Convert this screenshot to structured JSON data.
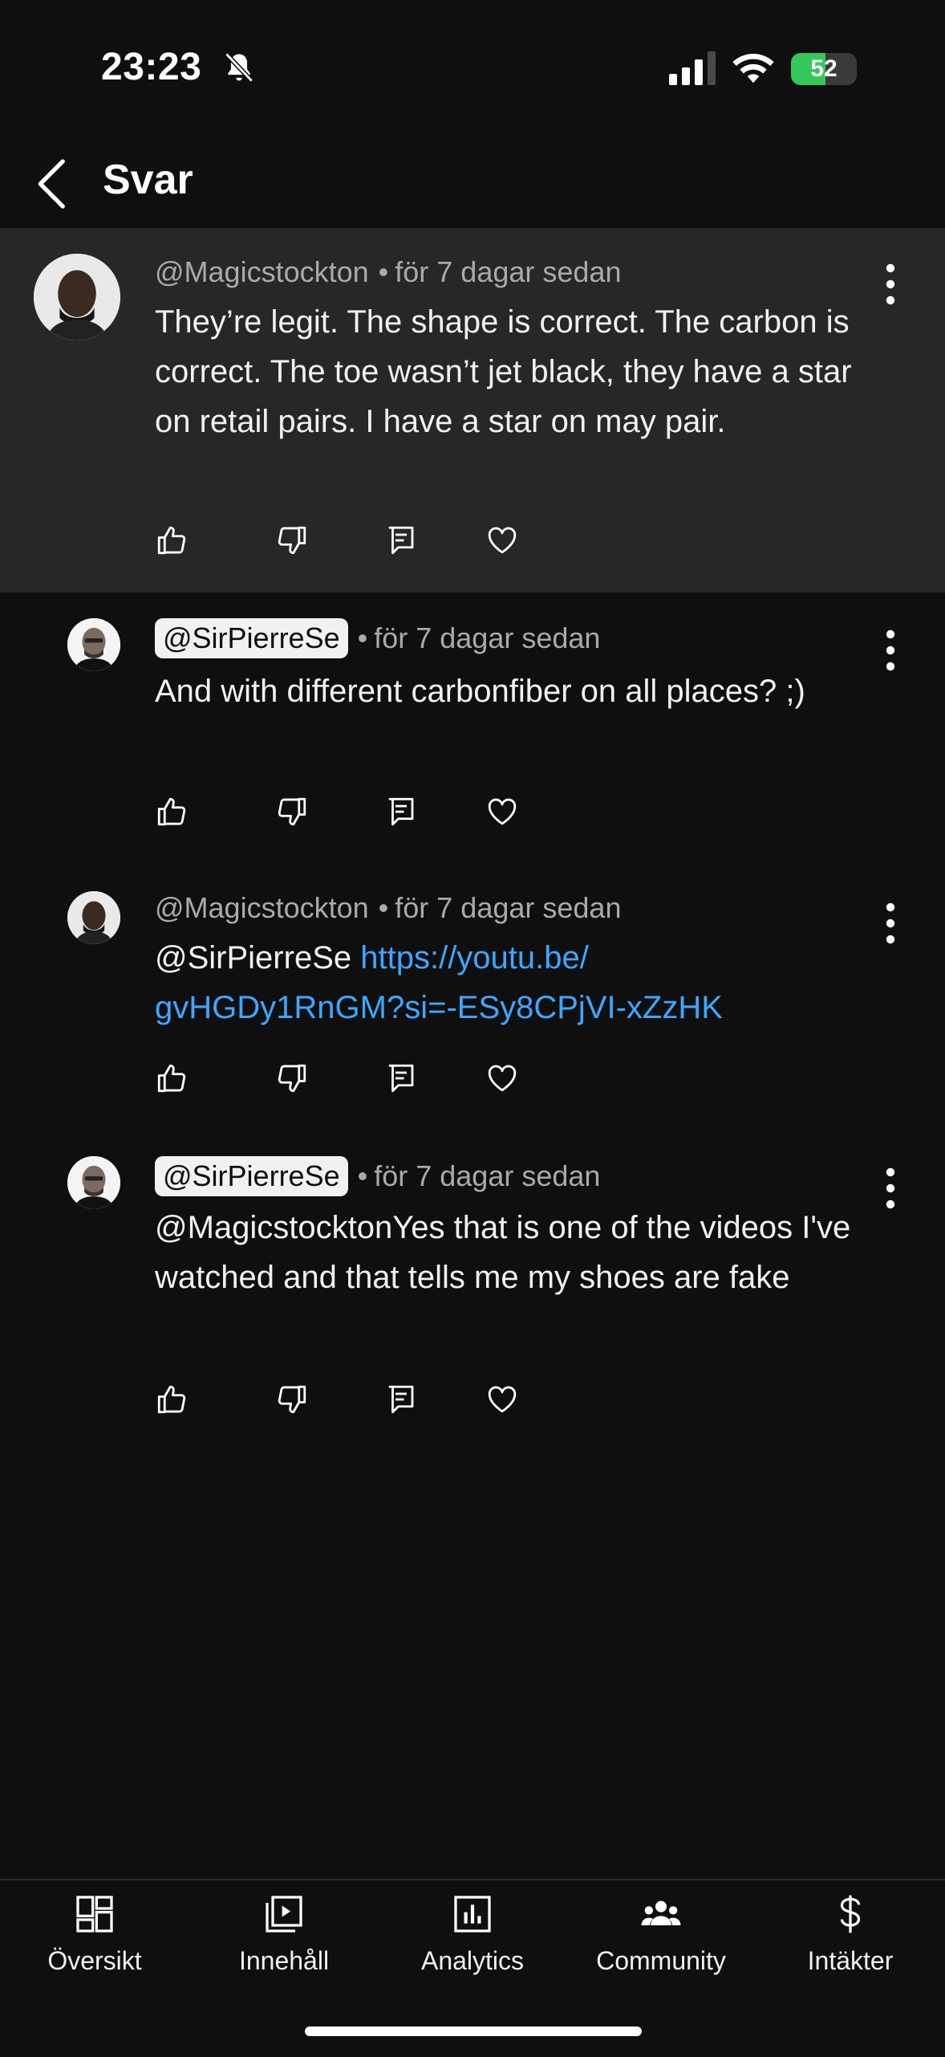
{
  "status_bar": {
    "time": "23:23",
    "battery": "52",
    "battery_level": 0.52
  },
  "header": {
    "title": "Svar"
  },
  "comments": [
    {
      "author": "@Magicstockton",
      "separator": "•",
      "time": "för 7 dagar sedan",
      "text": "They’re legit. The shape is correct. The carbon is correct. The toe wasn’t jet black, they have a star on retail pairs. I have a star on may pair."
    },
    {
      "author": "@SirPierreSe",
      "separator": "•",
      "time": "för 7 dagar sedan",
      "text": "And with different carbonfiber on all places? ;)"
    },
    {
      "author": "@Magicstockton",
      "separator": "•",
      "time": "för 7 dagar sedan",
      "mention": "@SirPierreSe",
      "link": "https://youtu.be/gvHGDy1RnGM?si=-ESy8CPjVI-xZzHK"
    },
    {
      "author": "@SirPierreSe",
      "separator": "•",
      "time": "för 7 dagar sedan",
      "text": "@MagicstocktonYes that is one of the videos I've watched and that tells me my shoes are fake"
    }
  ],
  "link_display": {
    "line1": "https://youtu.be/",
    "line2": "gvHGDy1RnGM?si=-ESy8CPjVI-xZzHK"
  },
  "nav": {
    "items": [
      {
        "label": "Översikt",
        "icon": "dashboard-icon"
      },
      {
        "label": "Innehåll",
        "icon": "content-icon"
      },
      {
        "label": "Analytics",
        "icon": "analytics-icon"
      },
      {
        "label": "Community",
        "icon": "community-icon"
      },
      {
        "label": "Intäkter",
        "icon": "dollar-icon"
      }
    ]
  },
  "colors": {
    "background": "#0f0f0f",
    "highlight": "#272727",
    "link": "#3ea6ff",
    "battery": "#34c759"
  }
}
